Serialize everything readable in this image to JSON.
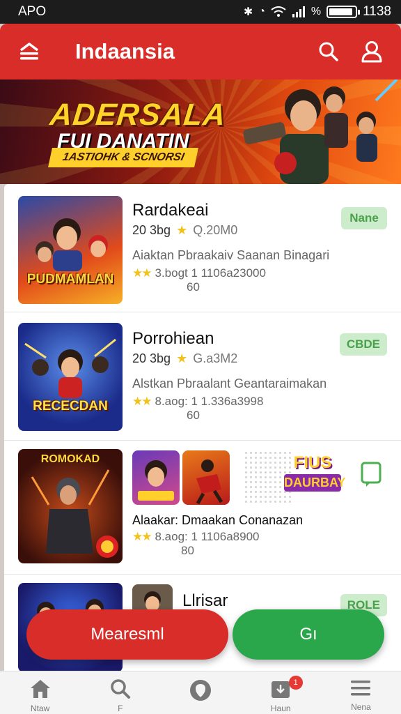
{
  "status_bar": {
    "carrier": "APO",
    "time": "1138",
    "battery_level": 0.9
  },
  "app_bar": {
    "title": "Indaansia",
    "menu_icon": "menu-icon",
    "search_icon": "search-icon",
    "profile_icon": "profile-icon"
  },
  "banner": {
    "title": "ADERSALA",
    "subtitle": "FUI DANATIN",
    "tag": "1ASTIOHK & SCNORSI"
  },
  "rows": [
    {
      "thumb_label": "PUDMAMLAN",
      "title": "Rardakeai",
      "size": "20 3bg",
      "rating_text": "Q.20M0",
      "description": "Aiaktan Pbraakaiv Saanan Binagari",
      "downloads": "3.bogt 1 1106a23000",
      "count": "60",
      "badge": "Nane"
    },
    {
      "thumb_label": "RECECDAN",
      "title": "Porrohiean",
      "size": "20 3bg",
      "rating_text": "G.a3M2",
      "description": "Alstkan Pbraalant Geantaraimakan",
      "downloads": "8.aog: 1 1.336a3998",
      "count": "60",
      "badge": "CBDE"
    },
    {
      "thumb_label": "",
      "title": "",
      "size": "",
      "rating_text": "",
      "description": "Alaakar: Dmaakan Conanazan",
      "downloads": "8.aog: 1 1106a8900",
      "count": "80",
      "badge": "",
      "top_label": "ROMOKAD",
      "mini_label": "DAURBAY",
      "mini_top": "FIUS"
    },
    {
      "thumb_label": "",
      "title": "Llrisar",
      "badge": "ROLE"
    }
  ],
  "buttons": {
    "primary": "Mearesml",
    "secondary": "Gı"
  },
  "bottom_nav": [
    {
      "label": "Ntaw",
      "icon": "home-icon"
    },
    {
      "label": "F",
      "icon": "search-icon"
    },
    {
      "label": "",
      "icon": "location-icon"
    },
    {
      "label": "Haun",
      "icon": "download-icon",
      "badge": "1"
    },
    {
      "label": "Nena",
      "icon": "menu-icon"
    }
  ],
  "colors": {
    "primary": "#d92d2a",
    "accent_green": "#2aa74a",
    "badge_bg": "#cdeccb",
    "badge_text": "#48a14a"
  }
}
